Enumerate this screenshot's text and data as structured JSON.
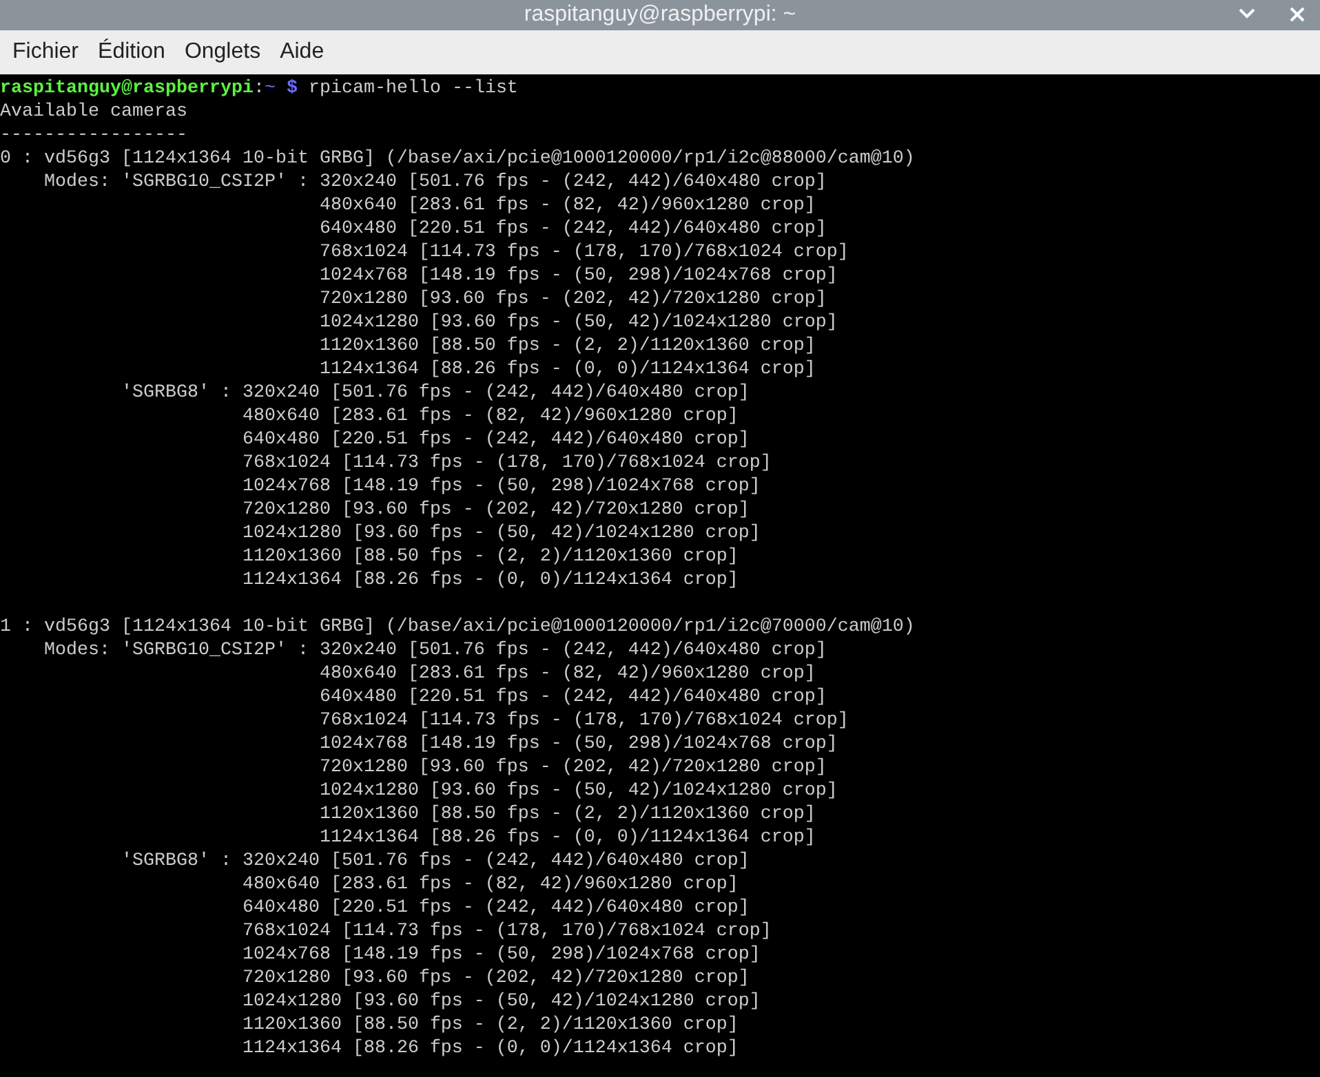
{
  "window": {
    "title": "raspitanguy@raspberrypi: ~"
  },
  "menu": [
    "Fichier",
    "Édition",
    "Onglets",
    "Aide"
  ],
  "terminal": {
    "prompt": {
      "user_host": "raspitanguy@raspberrypi",
      "separator": ":",
      "path": "~",
      "symbol": "$",
      "command": "rpicam-hello --list"
    },
    "output_blocks": [
      [
        "Available cameras",
        "-----------------",
        "0 : vd56g3 [1124x1364 10-bit GRBG] (/base/axi/pcie@1000120000/rp1/i2c@88000/cam@10)",
        "    Modes: 'SGRBG10_CSI2P' : 320x240 [501.76 fps - (242, 442)/640x480 crop]",
        "                             480x640 [283.61 fps - (82, 42)/960x1280 crop]",
        "                             640x480 [220.51 fps - (242, 442)/640x480 crop]",
        "                             768x1024 [114.73 fps - (178, 170)/768x1024 crop]",
        "                             1024x768 [148.19 fps - (50, 298)/1024x768 crop]",
        "                             720x1280 [93.60 fps - (202, 42)/720x1280 crop]",
        "                             1024x1280 [93.60 fps - (50, 42)/1024x1280 crop]",
        "                             1120x1360 [88.50 fps - (2, 2)/1120x1360 crop]",
        "                             1124x1364 [88.26 fps - (0, 0)/1124x1364 crop]",
        "           'SGRBG8' : 320x240 [501.76 fps - (242, 442)/640x480 crop]",
        "                      480x640 [283.61 fps - (82, 42)/960x1280 crop]",
        "                      640x480 [220.51 fps - (242, 442)/640x480 crop]",
        "                      768x1024 [114.73 fps - (178, 170)/768x1024 crop]",
        "                      1024x768 [148.19 fps - (50, 298)/1024x768 crop]",
        "                      720x1280 [93.60 fps - (202, 42)/720x1280 crop]",
        "                      1024x1280 [93.60 fps - (50, 42)/1024x1280 crop]",
        "                      1120x1360 [88.50 fps - (2, 2)/1120x1360 crop]",
        "                      1124x1364 [88.26 fps - (0, 0)/1124x1364 crop]"
      ],
      [
        "1 : vd56g3 [1124x1364 10-bit GRBG] (/base/axi/pcie@1000120000/rp1/i2c@70000/cam@10)",
        "    Modes: 'SGRBG10_CSI2P' : 320x240 [501.76 fps - (242, 442)/640x480 crop]",
        "                             480x640 [283.61 fps - (82, 42)/960x1280 crop]",
        "                             640x480 [220.51 fps - (242, 442)/640x480 crop]",
        "                             768x1024 [114.73 fps - (178, 170)/768x1024 crop]",
        "                             1024x768 [148.19 fps - (50, 298)/1024x768 crop]",
        "                             720x1280 [93.60 fps - (202, 42)/720x1280 crop]",
        "                             1024x1280 [93.60 fps - (50, 42)/1024x1280 crop]",
        "                             1120x1360 [88.50 fps - (2, 2)/1120x1360 crop]",
        "                             1124x1364 [88.26 fps - (0, 0)/1124x1364 crop]",
        "           'SGRBG8' : 320x240 [501.76 fps - (242, 442)/640x480 crop]",
        "                      480x640 [283.61 fps - (82, 42)/960x1280 crop]",
        "                      640x480 [220.51 fps - (242, 442)/640x480 crop]",
        "                      768x1024 [114.73 fps - (178, 170)/768x1024 crop]",
        "                      1024x768 [148.19 fps - (50, 298)/1024x768 crop]",
        "                      720x1280 [93.60 fps - (202, 42)/720x1280 crop]",
        "                      1024x1280 [93.60 fps - (50, 42)/1024x1280 crop]",
        "                      1120x1360 [88.50 fps - (2, 2)/1120x1360 crop]",
        "                      1124x1364 [88.26 fps - (0, 0)/1124x1364 crop]"
      ]
    ]
  }
}
